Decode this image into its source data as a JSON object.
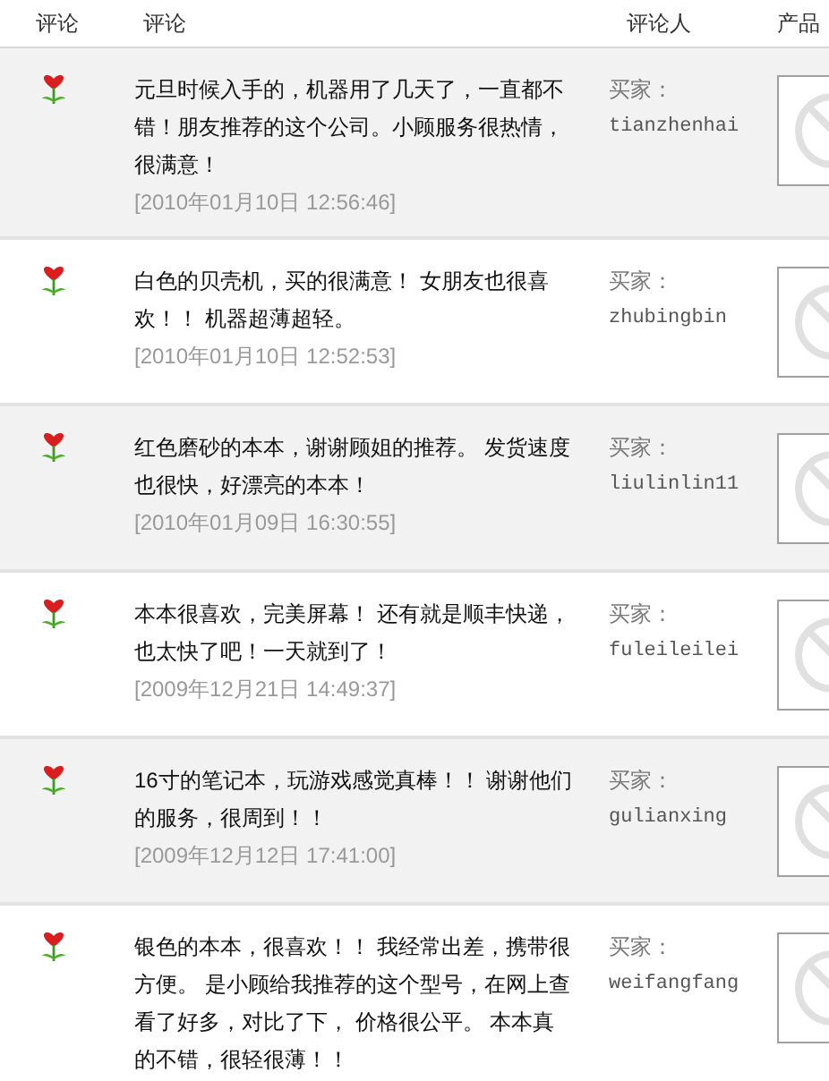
{
  "header": [
    "评论",
    "评论",
    "评论人",
    "产品"
  ],
  "reviews": [
    {
      "text": "元旦时候入手的，机器用了几天了，一直都不错！朋友推荐的这个公司。小顾服务很热情，很满意！",
      "date": "[2010年01月10日 12:56:46]",
      "buyer_label": "买家：",
      "buyer": "tianzhenhai"
    },
    {
      "text": "白色的贝壳机，买的很满意！ 女朋友也很喜欢！！ 机器超薄超轻。",
      "date": "[2010年01月10日 12:52:53]",
      "buyer_label": "买家：",
      "buyer": "zhubingbin"
    },
    {
      "text": "红色磨砂的本本，谢谢顾姐的推荐。 发货速度也很快，好漂亮的本本！",
      "date": "[2010年01月09日 16:30:55]",
      "buyer_label": "买家：",
      "buyer": "liulinlin11"
    },
    {
      "text": "本本很喜欢，完美屏幕！ 还有就是顺丰快递，也太快了吧！一天就到了！",
      "date": "[2009年12月21日 14:49:37]",
      "buyer_label": "买家：",
      "buyer": "fuleileilei"
    },
    {
      "text": "16寸的笔记本，玩游戏感觉真棒！！ 谢谢他们的服务，很周到！！",
      "date": "[2009年12月12日 17:41:00]",
      "buyer_label": "买家：",
      "buyer": "gulianxing"
    },
    {
      "text": "银色的本本，很喜欢！！ 我经常出差，携带很方便。 是小顾给我推荐的这个型号，在网上查看了好多，对比了下， 价格很公平。 本本真的不错，很轻很薄！！",
      "buyer_label": "买家：",
      "buyer": "weifangfang"
    }
  ]
}
